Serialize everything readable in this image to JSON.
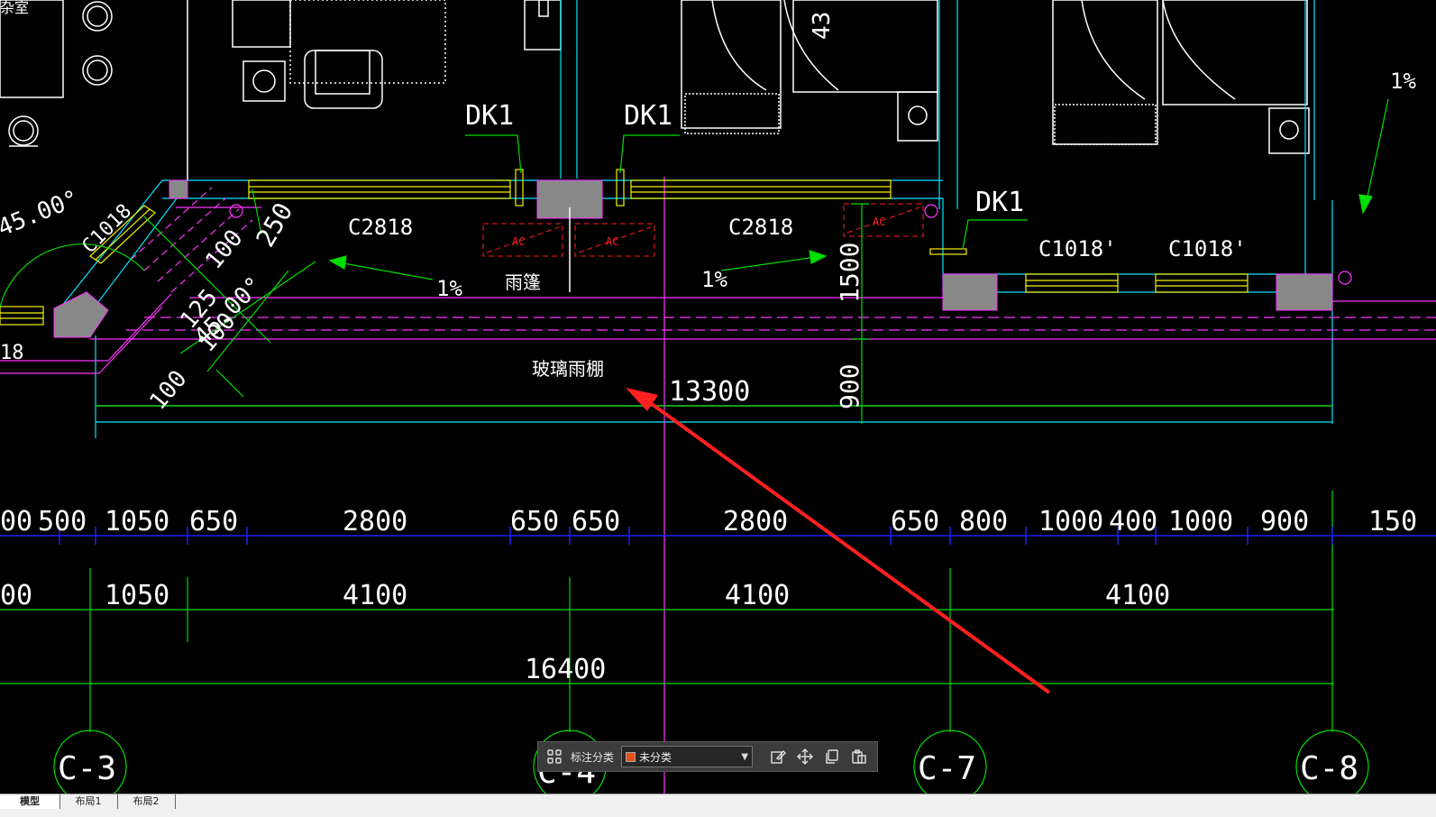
{
  "drawing": {
    "room_label": "杂室",
    "door_labels": [
      "DK1",
      "DK1",
      "DK1"
    ],
    "window_labels": [
      "C2818",
      "C2818",
      "C1018'",
      "C1018'",
      "C1018"
    ],
    "slope_labels": [
      "1%",
      "1%",
      "1%"
    ],
    "canopy_label": "雨篷",
    "glass_canopy_label": "玻璃雨棚",
    "ac_labels": [
      "AC",
      "AC",
      "AC"
    ],
    "angle_label": "45.00°",
    "angle_label2": "45.00°",
    "side_dims": [
      "250",
      "100",
      "125",
      "100",
      "100",
      "18",
      "43"
    ],
    "vertical_dims": [
      "1500",
      "900"
    ],
    "overall_dim": "13300",
    "dim_row1": [
      "00",
      "500",
      "1050",
      "650",
      "2800",
      "650",
      "650",
      "2800",
      "650",
      "800",
      "1000",
      "400",
      "1000",
      "900",
      "150"
    ],
    "dim_row2": [
      "00",
      "1050",
      "4100",
      "4100",
      "4100"
    ],
    "dim_total": "16400",
    "axis_labels": [
      "C-3",
      "C-4",
      "C-7",
      "C-8"
    ]
  },
  "toolbar": {
    "label": "标注分类",
    "select_value": "未分类",
    "swatch_color": "#e8501a",
    "icons": [
      "grid-icon",
      "edit-icon",
      "move-icon",
      "copy-icon",
      "paste-icon"
    ]
  },
  "tabs": [
    "模型",
    "布局1",
    "布局2"
  ],
  "colors": {
    "cyan": "#00e5ff",
    "green": "#00dd00",
    "magenta": "#ff33ff",
    "yellow": "#f2f200",
    "blue": "#2020ff",
    "red": "#ff2020",
    "gray_fill": "#888888"
  }
}
